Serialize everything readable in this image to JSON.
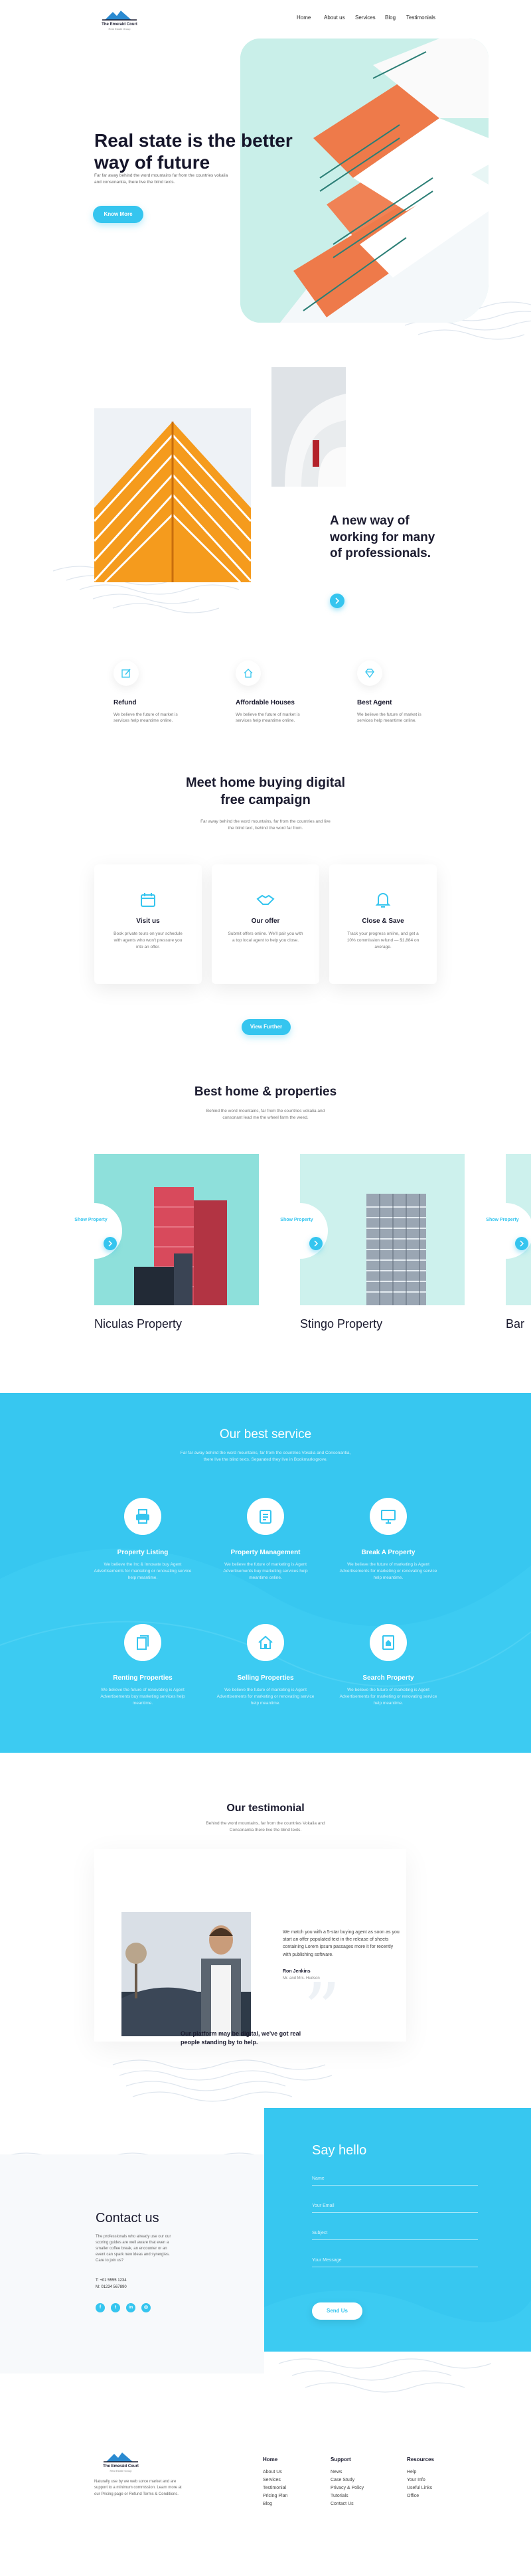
{
  "brand": {
    "name": "The Emerald Court",
    "tagline": "Real Estate Group"
  },
  "nav": {
    "items": [
      "Home",
      "About us",
      "Services",
      "Blog",
      "Testimonials"
    ]
  },
  "hero": {
    "title": "Real state is the better way of future",
    "subtitle": "Far far away behind the word mountains far from the countries vokalia and consonantia, there live the blind texts.",
    "cta": "Know More"
  },
  "about": {
    "title": "A new way of working for many of professionals."
  },
  "features": [
    {
      "icon": "edit-icon",
      "title": "Refund",
      "text": "We believe the future of market is services help meantime online."
    },
    {
      "icon": "house-icon",
      "title": "Affordable Houses",
      "text": "We believe the future of market is services help meantime online."
    },
    {
      "icon": "diamond-icon",
      "title": "Best Agent",
      "text": "We believe the future of market is services help meantime online."
    }
  ],
  "campaign": {
    "title": "Meet home buying digital free campaign",
    "subtitle": "Far away behind the word mountains, far from the countries and live the blind text, behind the word far from.",
    "cards": [
      {
        "icon": "calendar-icon",
        "title": "Visit us",
        "text": "Book private tours on your schedule with agents who won't pressure you into an offer."
      },
      {
        "icon": "handshake-icon",
        "title": "Our offer",
        "text": "Submit offers online. We'll pair you with a top local agent to help you close."
      },
      {
        "icon": "bell-icon",
        "title": "Close & Save",
        "text": "Track your progress online, and get a 10% commission refund — $1,884 on average."
      }
    ],
    "cta": "View Further"
  },
  "properties": {
    "title": "Best home & properties",
    "subtitle": "Behind the word mountains, far from the countries vokalia and consonant lead me the wheel farm the weed.",
    "badge_label": "Show Property",
    "items": [
      {
        "name": "Niculas Property"
      },
      {
        "name": "Stingo Property"
      },
      {
        "name": "Bar"
      }
    ]
  },
  "services": {
    "title": "Our best service",
    "subtitle": "Far far away behind the word mountains, far from the countries Vokalia and Consonantia, there live the blind texts. Separated they live in Bookmarksgrove.",
    "items": [
      {
        "icon": "printer-icon",
        "title": "Property Listing",
        "text": "We believe the Inc & Innovate buy Agent Advertisements for marketing or renovating service help meantime."
      },
      {
        "icon": "clipboard-icon",
        "title": "Property Management",
        "text": "We believe the future of marketing is Agent Advertisements buy marketing services help meantime online."
      },
      {
        "icon": "monitor-icon",
        "title": "Break A Property",
        "text": "We believe the future of marketing is Agent Advertisements for marketing or renovating service help meantime."
      },
      {
        "icon": "files-icon",
        "title": "Renting Properties",
        "text": "We believe the future of renovating is Agent Advertisements buy marketing services help meantime."
      },
      {
        "icon": "house-icon",
        "title": "Selling Properties",
        "text": "We believe the future of marketing is Agent Advertisements for marketing or renovating service help meantime."
      },
      {
        "icon": "document-icon",
        "title": "Search Property",
        "text": "We believe the future of marketing is Agent Advertisements for marketing or renovating service help meantime."
      }
    ]
  },
  "testimonial": {
    "title": "Our testimonial",
    "subtitle": "Behind the word mountains, far from the countries Vokalia and Consonantia there live the blind texts.",
    "quote": "We match you with a 5-star buying agent as soon as you start an offer populated text in the release of sheets containing Lorem ipsum passages more it for recently with publishing software.",
    "author": "Ron Jenkins",
    "role": "Mr. and Mrs. Hudson",
    "tagline": "Our platform may be digital, we've got real people standing by to help."
  },
  "contact": {
    "title": "Contact us",
    "text": "The professionals who already use our our scoring guides are well aware that even a smaller coffee break, an encounter or an event can spark new ideas and synergies. Care to join us?",
    "phone": "T: +01 5555 1234",
    "phone2": "M: 01234 567890",
    "form": {
      "title": "Say hello",
      "fields": [
        "Name",
        "Your Email",
        "Subject",
        "Your Message"
      ],
      "send": "Send Us"
    }
  },
  "footer": {
    "about": "Naturally use by we web sorce market and are support to a minimum commission. Learn more at our Pricing page or Refund Terms & Conditions.",
    "columns": [
      {
        "title": "Home",
        "links": [
          "About Us",
          "Services",
          "Testimonial",
          "Pricing Plan",
          "Blog"
        ]
      },
      {
        "title": "Support",
        "links": [
          "News",
          "Case Study",
          "Privacy & Policy",
          "Tutorials",
          "Contact Us"
        ]
      },
      {
        "title": "Resources",
        "links": [
          "Help",
          "Your Info",
          "Useful Links",
          "Office"
        ]
      }
    ]
  }
}
